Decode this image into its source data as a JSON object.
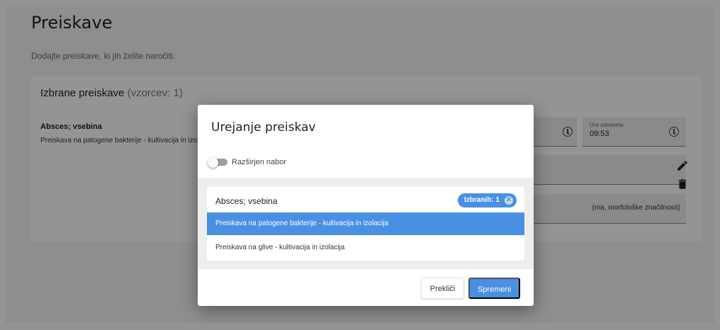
{
  "page": {
    "title": "Preiskave",
    "subtitle": "Dodajte preiskave, ki jih želite naročiti.",
    "card": {
      "title_main": "Izbrane preiskave",
      "title_count": "(vzorcev: 1)",
      "sample_name": "Absces; vsebina",
      "sample_test": "Preiskava na patogene bakterije - kultivacija in izolacija",
      "time_field": {
        "label": "Ura odvzema",
        "value": "09:53"
      },
      "note_field_value": "(ma, morfološke značilnosti)"
    },
    "icons": {
      "clock": "clock-icon",
      "edit": "edit-icon",
      "delete": "delete-icon"
    }
  },
  "modal": {
    "title": "Urejanje preiskav",
    "toggle_label": "Razširjen nabor",
    "toggle_on": false,
    "list": {
      "group_name": "Absces; vsebina",
      "chip_label": "Izbranih: 1",
      "items": [
        {
          "label": "Preiskava na patogene bakterije - kultivacija in izolacija",
          "selected": true
        },
        {
          "label": "Preiskava na glive - kultivacija in izolacija",
          "selected": false
        }
      ]
    },
    "buttons": {
      "cancel": "Prekliči",
      "save": "Spremeni"
    }
  },
  "colors": {
    "accent": "#4a90e2",
    "overlay": "rgba(0,0,0,0.42)"
  }
}
